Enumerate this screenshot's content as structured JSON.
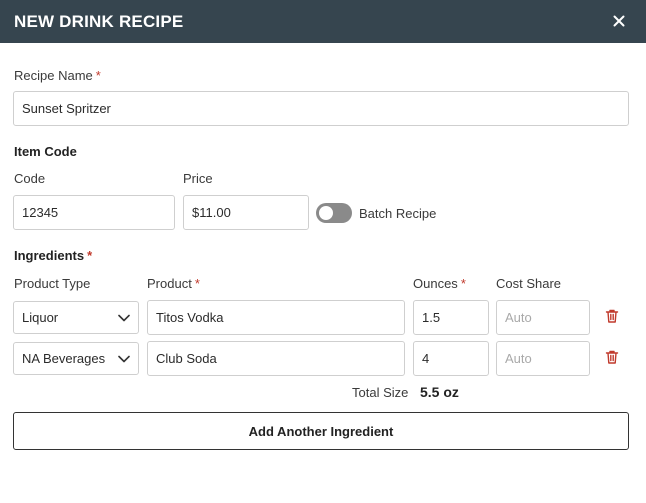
{
  "header": {
    "title": "NEW DRINK RECIPE"
  },
  "recipe_name": {
    "label": "Recipe Name",
    "required_mark": "*",
    "value": "Sunset Spritzer"
  },
  "item_code": {
    "title": "Item Code",
    "code_label": "Code",
    "code_value": "12345",
    "price_label": "Price",
    "price_value": "$11.00",
    "batch_label": "Batch Recipe"
  },
  "ingredients": {
    "title": "Ingredients",
    "required_mark": "*",
    "columns": {
      "product_type": "Product Type",
      "product": "Product",
      "ounces": "Ounces",
      "cost_share": "Cost Share"
    },
    "rows": [
      {
        "product_type": "Liquor",
        "product": "Titos Vodka",
        "ounces": "1.5",
        "cost_share_placeholder": "Auto"
      },
      {
        "product_type": "NA Beverages",
        "product": "Club Soda",
        "ounces": "4",
        "cost_share_placeholder": "Auto"
      }
    ],
    "total_label": "Total Size",
    "total_value": "5.5 oz"
  },
  "actions": {
    "add_label": "Add Another Ingredient"
  },
  "colors": {
    "header_bg": "#36454f",
    "required": "#c0392b",
    "trash": "#c0392b",
    "toggle_off": "#8a8a8a"
  },
  "icons": {
    "close": "close-icon",
    "dropdown": "chevron-down-icon",
    "delete": "trash-icon"
  }
}
